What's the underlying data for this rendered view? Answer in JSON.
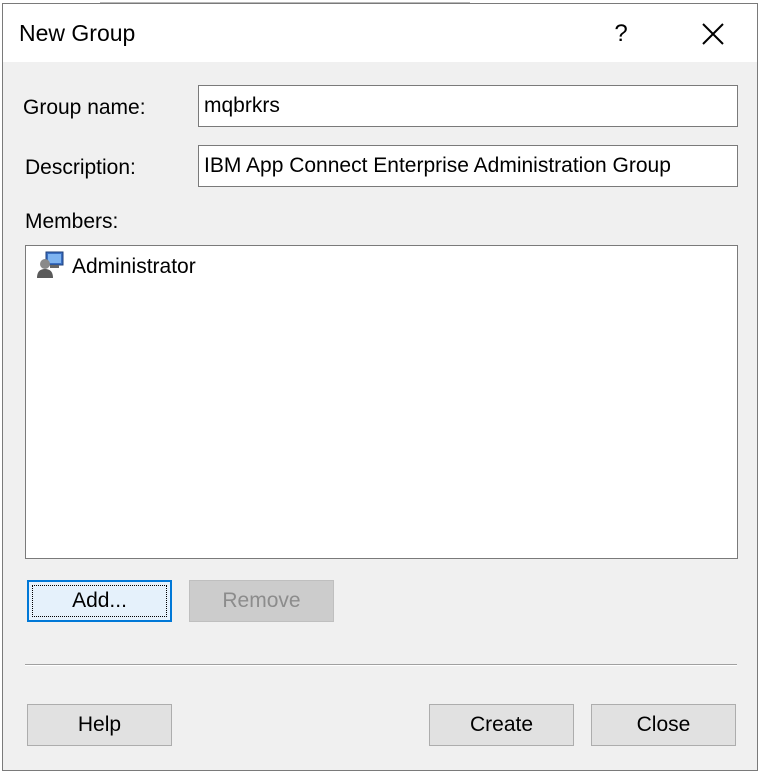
{
  "dialog": {
    "title": "New Group",
    "help_glyph": "?",
    "close_icon": "close-icon"
  },
  "form": {
    "group_name_label": "Group name:",
    "group_name_value": "mqbrkrs",
    "description_label": "Description:",
    "description_value": "IBM App Connect Enterprise Administration Group",
    "members_label": "Members:"
  },
  "members": [
    {
      "name": "Administrator",
      "icon": "user-computer-icon"
    }
  ],
  "buttons": {
    "add": "Add...",
    "remove": "Remove",
    "help": "Help",
    "create": "Create",
    "close": "Close"
  },
  "colors": {
    "accent": "#0078d7",
    "dialog_bg": "#f0f0f0"
  }
}
